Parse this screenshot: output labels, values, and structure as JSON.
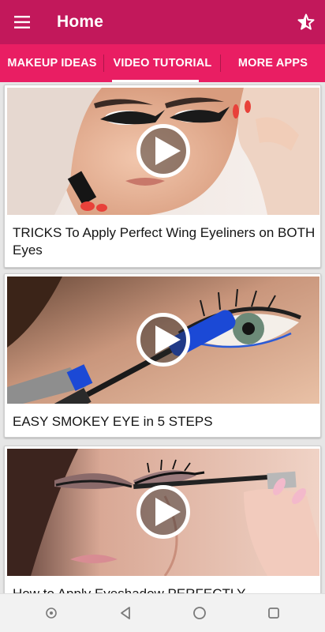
{
  "app_bar": {
    "title": "Home",
    "menu_icon": "hamburger-menu-icon",
    "rate_icon": "star-half-icon",
    "color": "#c2185b"
  },
  "tabs": {
    "color": "#e91e63",
    "selected": 1,
    "items": [
      {
        "label": "MAKEUP IDEAS"
      },
      {
        "label": "VIDEO TUTORIAL"
      },
      {
        "label": "MORE APPS"
      }
    ]
  },
  "videos": [
    {
      "title": "TRICKS To Apply Perfect Wing Eyeliners on BOTH Eyes",
      "thumbnail": "wing-eyeliner-face"
    },
    {
      "title": "EASY SMOKEY EYE in 5 STEPS",
      "thumbnail": "mascara-blue-eye"
    },
    {
      "title": "How to Apply Eyeshadow PERFECTLY",
      "thumbnail": "eyeshadow-mascara"
    }
  ],
  "system_nav": {
    "icons": [
      "assistant-dot-icon",
      "back-icon",
      "home-icon",
      "recents-icon"
    ]
  }
}
